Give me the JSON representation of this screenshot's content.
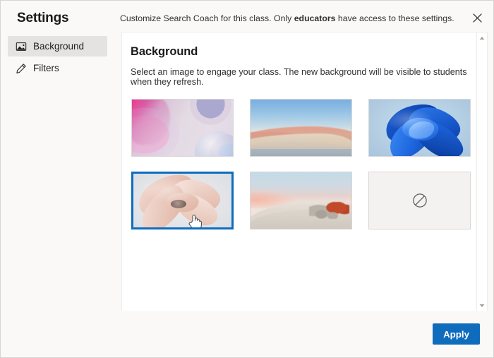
{
  "dialog": {
    "title": "Settings",
    "header_note_prefix": "Customize Search Coach for this class. Only ",
    "header_note_bold": "educators",
    "header_note_suffix": " have access to these settings.",
    "close_icon": "close-icon"
  },
  "sidebar": {
    "items": [
      {
        "label": "Background",
        "icon": "image-icon",
        "selected": true
      },
      {
        "label": "Filters",
        "icon": "pencil-icon",
        "selected": false
      }
    ]
  },
  "panel": {
    "title": "Background",
    "description": "Select an image to engage your class. The new background will be visible to students when they refresh.",
    "thumbnails": [
      {
        "name": "abstract-bubbles",
        "selected": false
      },
      {
        "name": "desert-dunes",
        "selected": false
      },
      {
        "name": "windows-blue-bloom",
        "selected": false
      },
      {
        "name": "windows-pink-bloom",
        "selected": true
      },
      {
        "name": "white-sands-sunset",
        "selected": false
      },
      {
        "name": "no-background",
        "selected": false,
        "icon": "prohibition-icon"
      }
    ]
  },
  "scrollbar": {
    "up_arrow": "chevron-up-icon",
    "down_arrow": "chevron-down-icon"
  },
  "footer": {
    "apply_label": "Apply"
  },
  "colors": {
    "accent": "#0f6cbd",
    "surface": "#faf9f8",
    "panel": "#ffffff",
    "selected_nav": "#e4e3e1",
    "text": "#201f1e"
  },
  "cursor": {
    "type": "pointer-hand-cursor"
  }
}
